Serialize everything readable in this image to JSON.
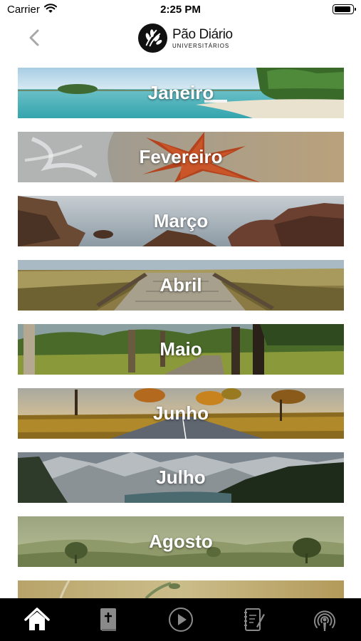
{
  "status_bar": {
    "carrier": "Carrier",
    "time": "2:25 PM"
  },
  "header": {
    "brand_line1": "Pão Diário",
    "brand_line2": "UNIVERSITÁRIOS"
  },
  "months": [
    "Janeiro",
    "Fevereiro",
    "Março",
    "Abril",
    "Maio",
    "Junho",
    "Julho",
    "Agosto",
    ""
  ],
  "tab_bar": {
    "items": [
      "home-icon",
      "bible-icon",
      "play-icon",
      "notebook-icon",
      "podcast-icon"
    ],
    "active": "home-icon",
    "active_color": "#ffffff",
    "inactive_color": "#8a8a8a"
  }
}
